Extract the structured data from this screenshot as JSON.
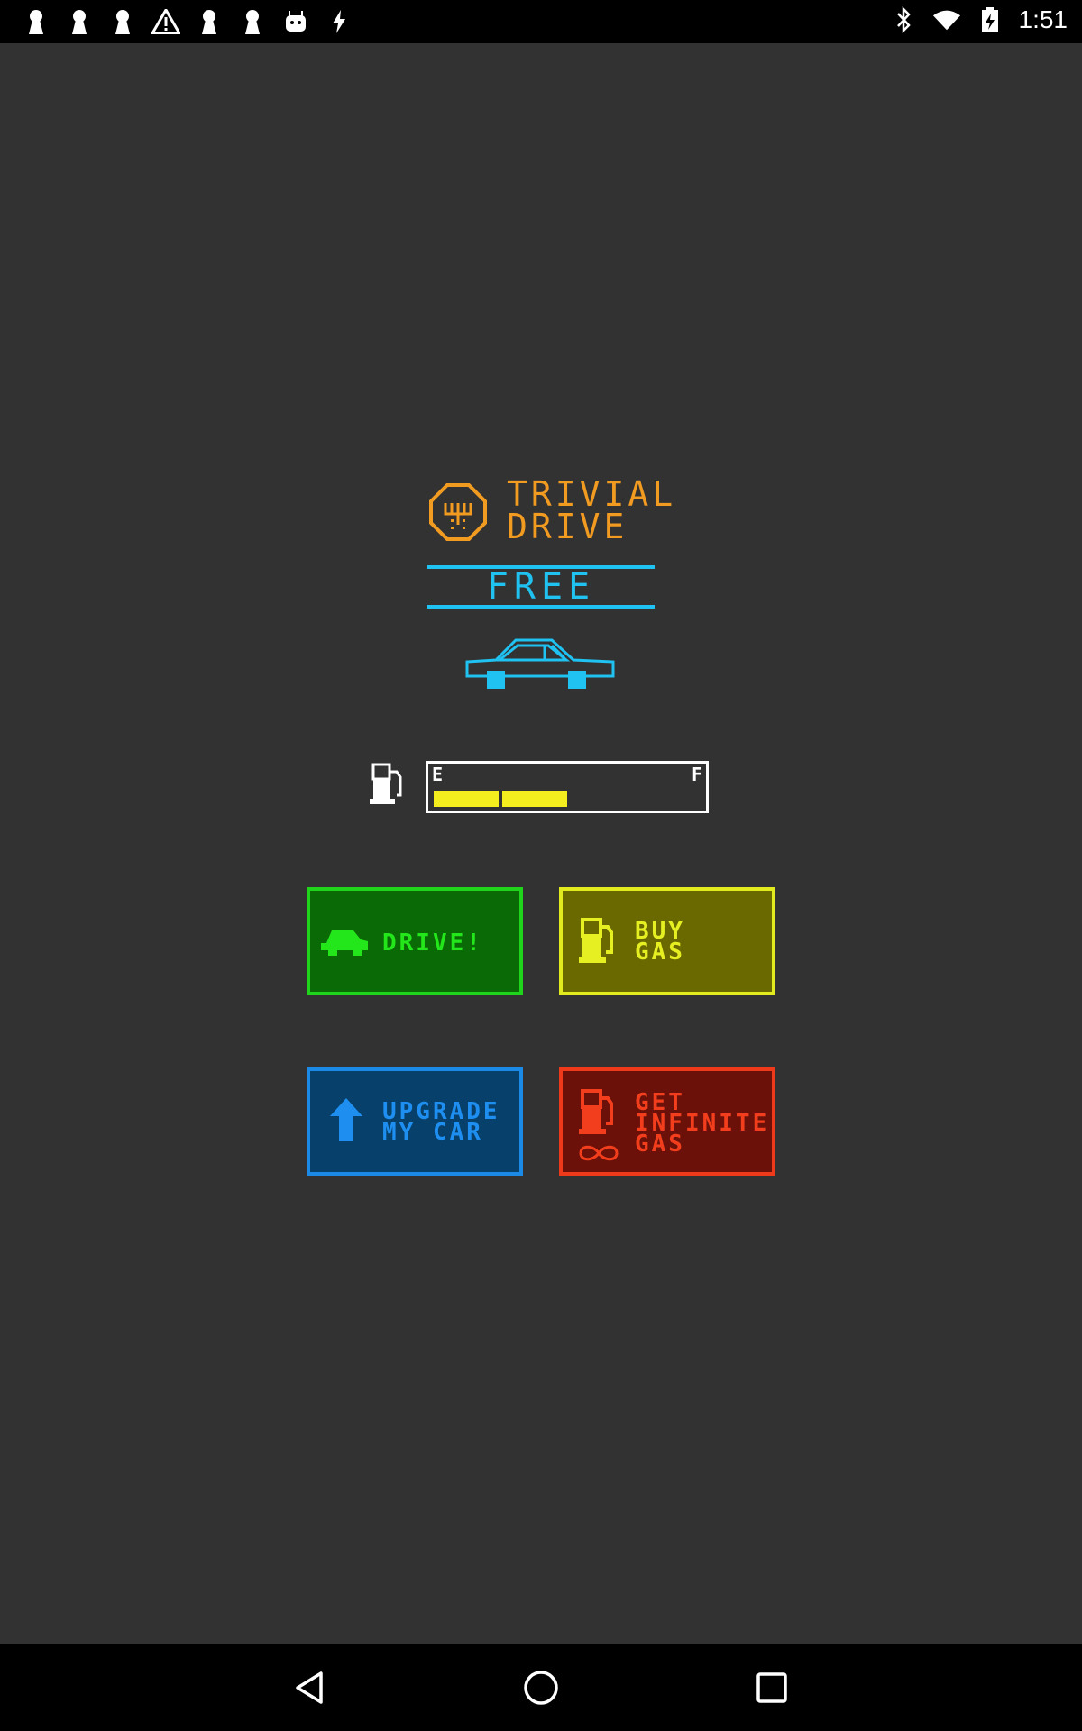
{
  "status_bar": {
    "left_icons": [
      "keyhole-icon",
      "keyhole-icon",
      "keyhole-icon",
      "warning-icon",
      "keyhole-icon",
      "keyhole-icon",
      "android-icon",
      "flash-icon"
    ],
    "right_icons": [
      "bluetooth-icon",
      "wifi-icon",
      "battery-charging-icon"
    ],
    "time": "1:51"
  },
  "app": {
    "title_line1": "TRIVIAL",
    "title_line2": "DRIVE",
    "edition": "FREE",
    "gas_gauge": {
      "empty_label": "E",
      "full_label": "F",
      "filled_segments": 2,
      "total_segments": 4
    },
    "buttons": {
      "drive": "DRIVE!",
      "buy_gas": "BUY\nGAS",
      "upgrade": "UPGRADE\nMY CAR",
      "infinite_gas": "GET\nINFINITE\nGAS"
    }
  },
  "colors": {
    "background": "#323232",
    "logo": "#f29b21",
    "edition": "#1fc2f0",
    "gauge_fill": "#f5ee1e",
    "drive": "#23e61b",
    "buy_gas": "#e6ef22",
    "upgrade": "#1e8ff0",
    "infinite": "#f23e1c"
  },
  "nav_bar": {
    "icons": [
      "back-icon",
      "home-icon",
      "recents-icon"
    ]
  }
}
